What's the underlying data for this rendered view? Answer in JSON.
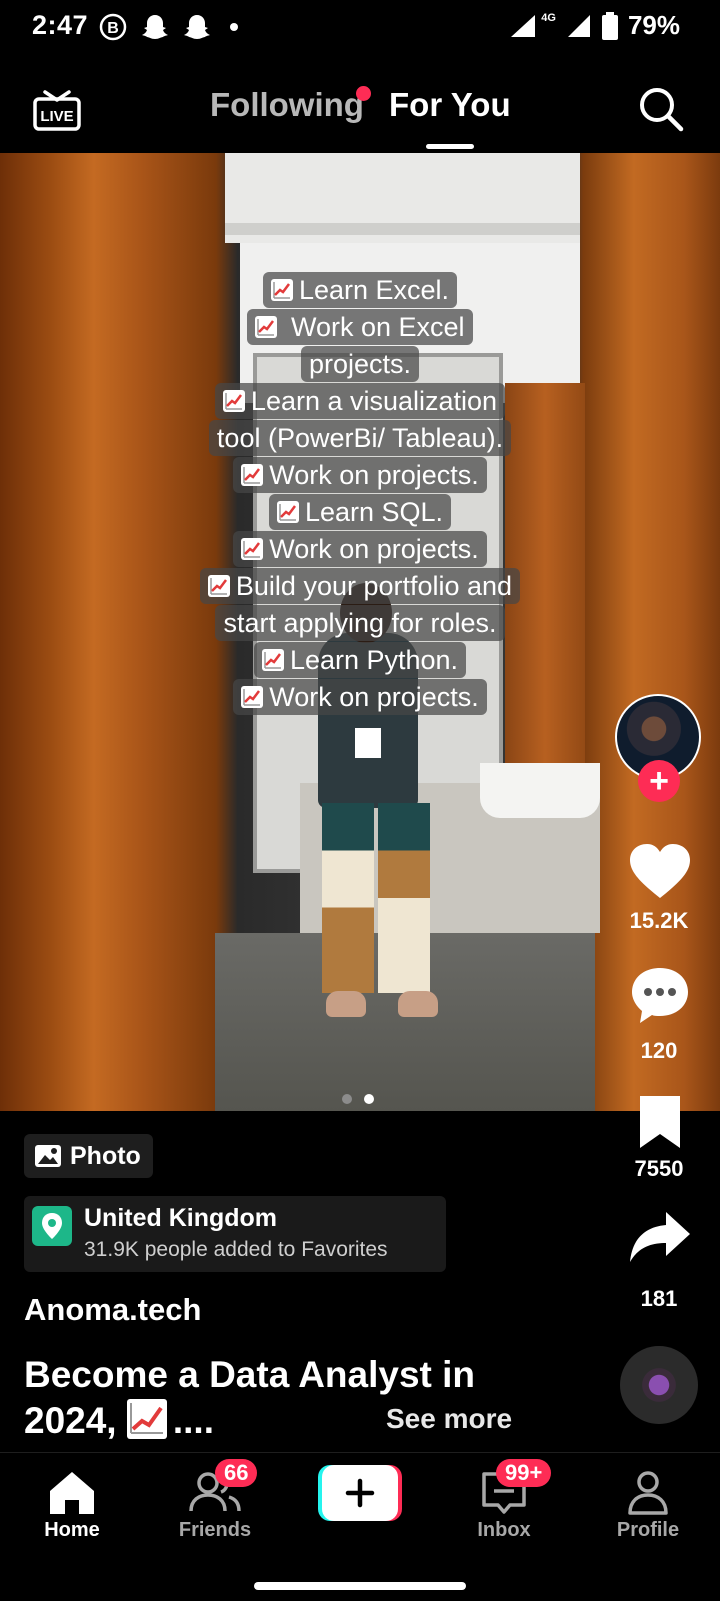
{
  "status_bar": {
    "time": "2:47",
    "battery": "79%",
    "network": "4G",
    "icons": [
      "b-icon",
      "snapchat-icon",
      "snapchat-icon",
      "dot-icon",
      "wifi-icon",
      "signal-icon",
      "battery-icon"
    ]
  },
  "top_nav": {
    "following_label": "Following",
    "for_you_label": "For You",
    "live_label": "LIVE"
  },
  "caption_overlay": {
    "lines": [
      "Learn Excel.",
      " Work on Excel",
      "projects.",
      "Learn a visualization",
      "tool (PowerBi/ Tableau).",
      "Work on projects.",
      "Learn SQL.",
      "Work on projects.",
      "Build your portfolio and",
      "start applying for roles.",
      "Learn Python.",
      "Work on projects."
    ],
    "emoji_lines": [
      0,
      1,
      3,
      5,
      6,
      7,
      8,
      10,
      11
    ]
  },
  "carousel": {
    "total": 2,
    "active": 2
  },
  "actions": {
    "likes": "15.2K",
    "comments": "120",
    "saves": "7550",
    "shares": "181"
  },
  "post": {
    "photo_tag": "Photo",
    "location_title": "United Kingdom",
    "location_subtitle": "31.9K people added to Favorites",
    "username": "Anoma.tech",
    "title_line1": "Become a Data Analyst in",
    "title_line2": "2024, ",
    "title_ellipsis": "....",
    "see_more": "See more"
  },
  "bottom_nav": {
    "home": "Home",
    "friends": "Friends",
    "friends_badge": "66",
    "inbox": "Inbox",
    "inbox_badge": "99+",
    "profile": "Profile"
  },
  "colors": {
    "accent": "#fe2c55",
    "location_icon": "#1db789",
    "create_left": "#25f4ee",
    "create_right": "#fe2c55"
  }
}
